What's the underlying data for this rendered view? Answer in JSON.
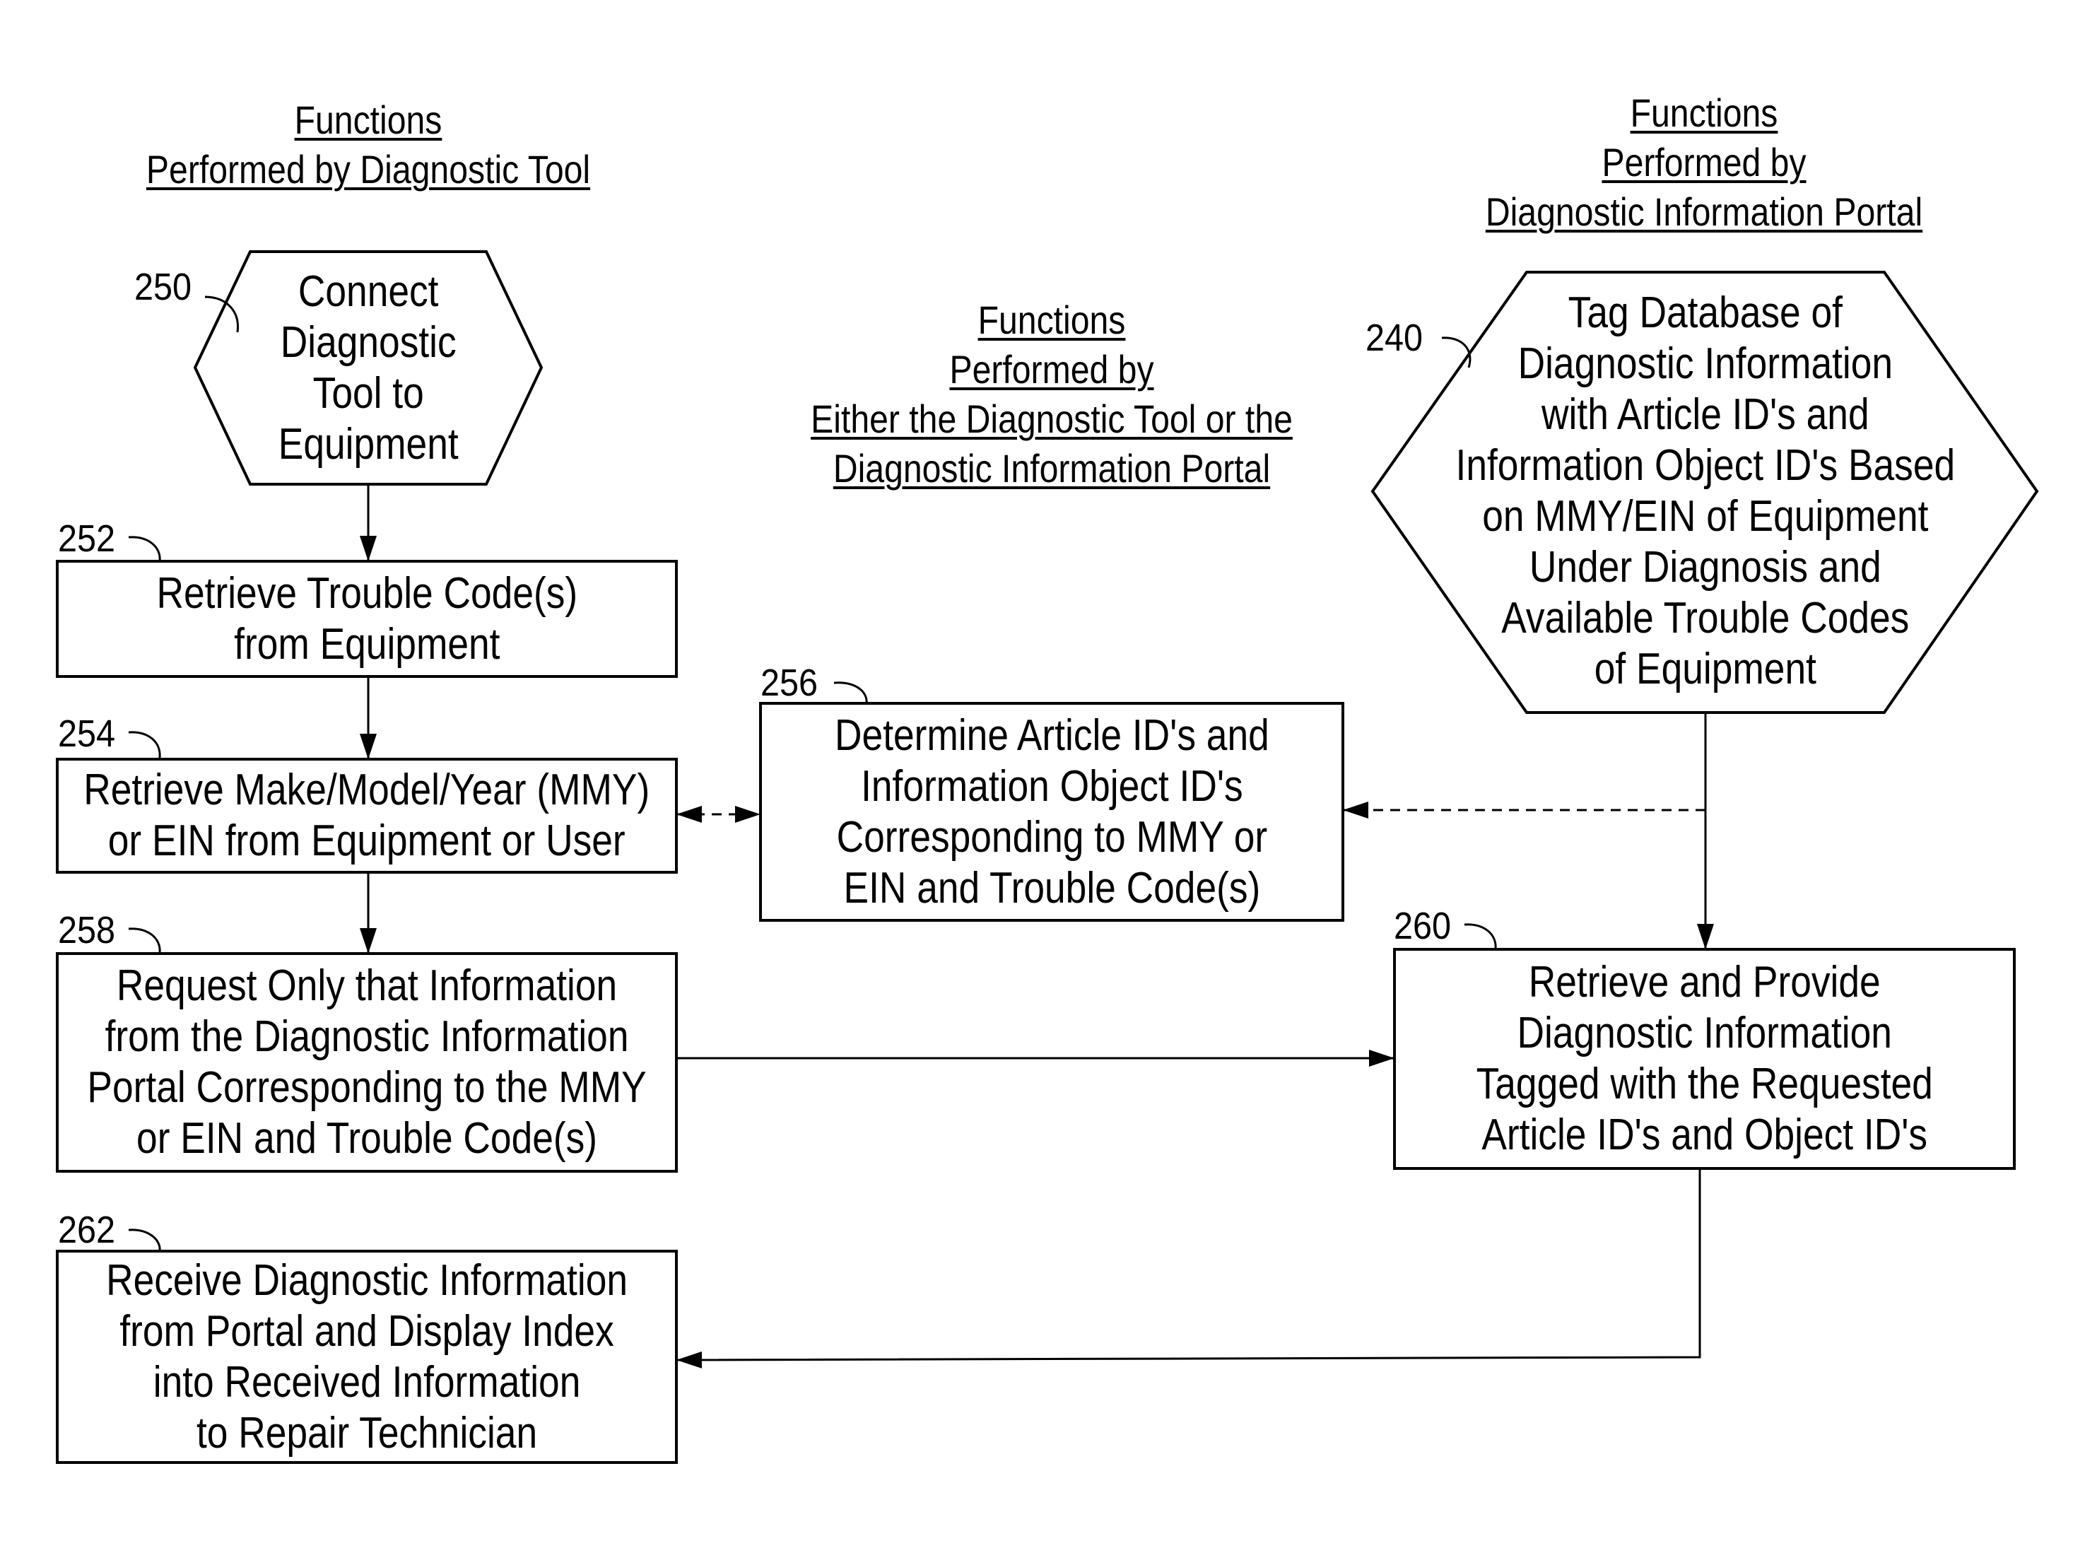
{
  "headers": {
    "diagnostic_tool": [
      "Functions",
      "Performed by Diagnostic Tool"
    ],
    "either": [
      "Functions",
      "Performed by",
      "Either the Diagnostic Tool or the",
      "Diagnostic Information Portal"
    ],
    "portal": [
      "Functions",
      "Performed by",
      "Diagnostic Information Portal"
    ]
  },
  "nodes": {
    "n250": {
      "ref": "250",
      "shape": "hexagon",
      "lines": [
        "Connect",
        "Diagnostic",
        "Tool to",
        "Equipment"
      ]
    },
    "n252": {
      "ref": "252",
      "shape": "box",
      "lines": [
        "Retrieve Trouble Code(s)",
        "from Equipment"
      ]
    },
    "n254": {
      "ref": "254",
      "shape": "box",
      "lines": [
        "Retrieve Make/Model/Year (MMY)",
        "or EIN from Equipment or User"
      ]
    },
    "n256": {
      "ref": "256",
      "shape": "box",
      "lines": [
        "Determine Article ID's and",
        "Information Object ID's",
        "Corresponding to MMY or",
        "EIN and Trouble Code(s)"
      ]
    },
    "n258": {
      "ref": "258",
      "shape": "box",
      "lines": [
        "Request Only that Information",
        "from the Diagnostic Information",
        "Portal Corresponding to the MMY",
        "or EIN and Trouble Code(s)"
      ]
    },
    "n262": {
      "ref": "262",
      "shape": "box",
      "lines": [
        "Receive Diagnostic Information",
        "from Portal and Display Index",
        "into Received Information",
        "to Repair Technician"
      ]
    },
    "n240": {
      "ref": "240",
      "shape": "hexagon",
      "lines": [
        "Tag Database of",
        "Diagnostic Information",
        "with Article ID's and",
        "Information Object ID's Based",
        "on MMY/EIN of Equipment",
        "Under Diagnosis and",
        "Available Trouble Codes",
        "of Equipment"
      ]
    },
    "n260": {
      "ref": "260",
      "shape": "box",
      "lines": [
        "Retrieve and Provide",
        "Diagnostic Information",
        "Tagged with the Requested",
        "Article ID's and Object ID's"
      ]
    }
  },
  "edges": [
    {
      "from": "250",
      "to": "252",
      "style": "solid"
    },
    {
      "from": "252",
      "to": "254",
      "style": "solid"
    },
    {
      "from": "254",
      "to": "258",
      "style": "solid"
    },
    {
      "from": "254",
      "to": "256",
      "style": "dashed",
      "bidirectional": true
    },
    {
      "from": "240",
      "to": "256",
      "style": "dashed"
    },
    {
      "from": "240",
      "to": "260",
      "style": "solid"
    },
    {
      "from": "258",
      "to": "260",
      "style": "solid"
    },
    {
      "from": "260",
      "to": "262",
      "style": "solid"
    }
  ]
}
